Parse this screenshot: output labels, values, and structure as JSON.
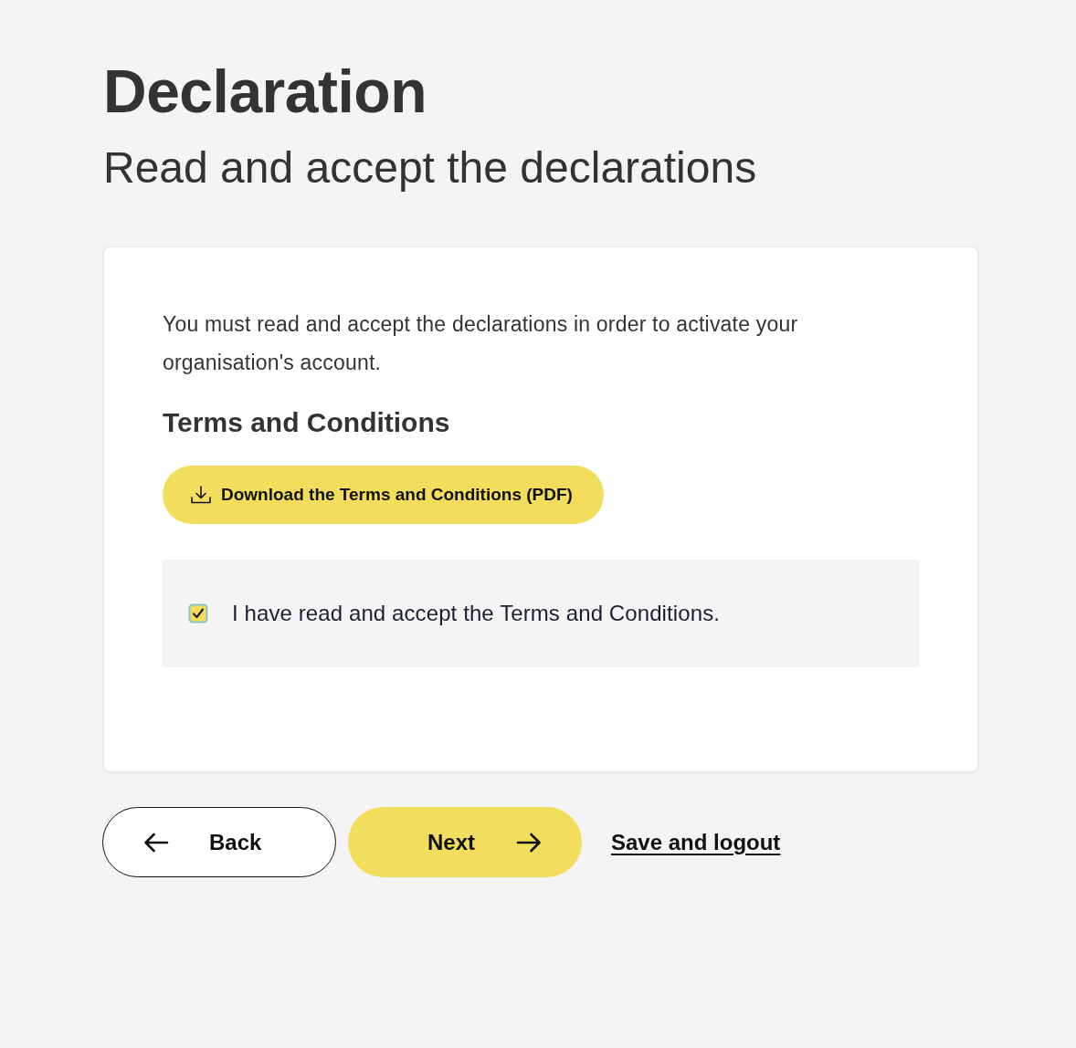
{
  "page": {
    "title": "Declaration",
    "subtitle": "Read and accept the declarations"
  },
  "card": {
    "intro": "You must read and accept the declarations in order to activate your organisation's account.",
    "section_title": "Terms and Conditions",
    "download_button": {
      "label": "Download the Terms and Conditions (PDF)"
    },
    "agreement": {
      "label": "I have read and accept the Terms and Conditions.",
      "checked": true
    }
  },
  "actions": [
    {
      "kind": "back",
      "label": "Back"
    },
    {
      "kind": "next",
      "label": "Next"
    },
    {
      "kind": "link",
      "label": "Save and logout"
    }
  ]
}
